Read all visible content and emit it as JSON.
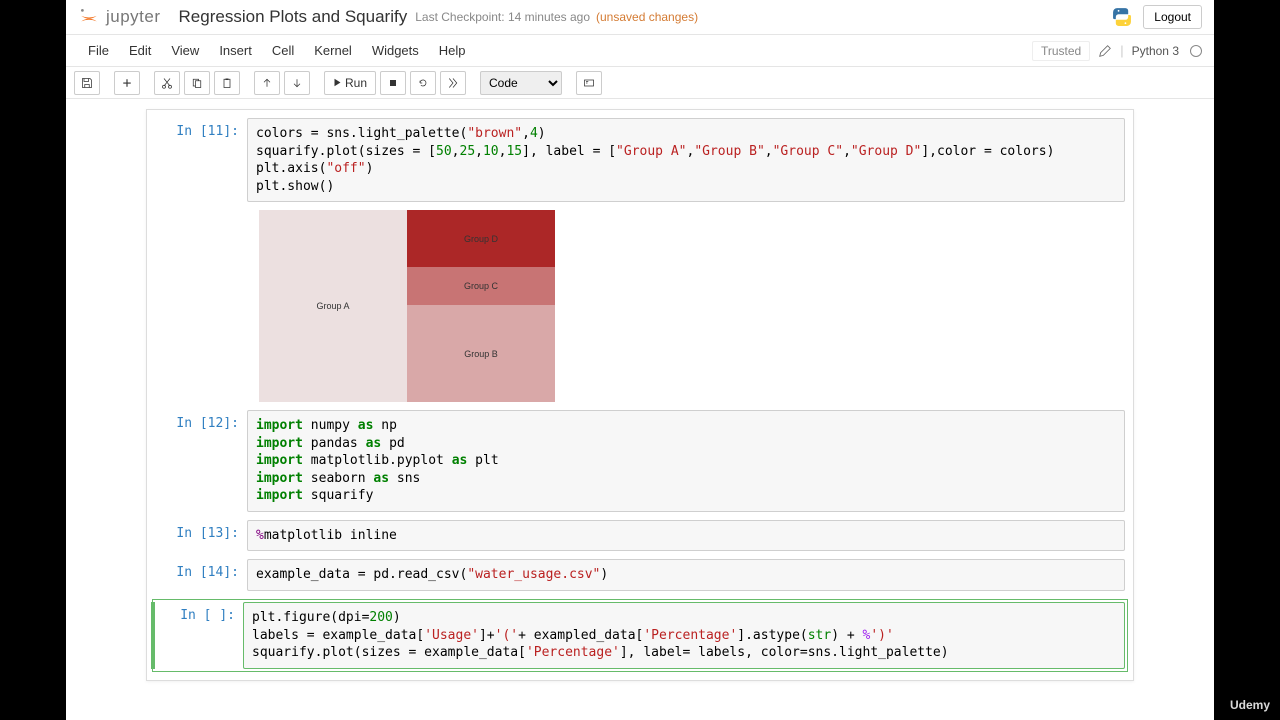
{
  "header": {
    "logo_text": "jupyter",
    "title": "Regression Plots and Squarify",
    "checkpoint": "Last Checkpoint: 14 minutes ago",
    "unsaved": "(unsaved changes)",
    "logout": "Logout"
  },
  "menu": {
    "file": "File",
    "edit": "Edit",
    "view": "View",
    "insert": "Insert",
    "cell": "Cell",
    "kernel": "Kernel",
    "widgets": "Widgets",
    "help": "Help",
    "trusted": "Trusted",
    "kernel_name": "Python 3"
  },
  "toolbar": {
    "run": "Run",
    "celltype": "Code"
  },
  "cells": {
    "c11_prompt": "In [11]:",
    "c12_prompt": "In [12]:",
    "c13_prompt": "In [13]:",
    "c14_prompt": "In [14]:",
    "c_empty_prompt": "In [ ]:"
  },
  "treemap": {
    "a": "Group A",
    "b": "Group B",
    "c": "Group C",
    "d": "Group D"
  },
  "chart_data": {
    "type": "area",
    "title": "",
    "series": [
      {
        "name": "Group A",
        "value": 50,
        "color": "#ece0e0"
      },
      {
        "name": "Group B",
        "value": 25,
        "color": "#d9a8a8"
      },
      {
        "name": "Group C",
        "value": 10,
        "color": "#c87474"
      },
      {
        "name": "Group D",
        "value": 15,
        "color": "#ac2727"
      }
    ]
  },
  "watermark": "Udemy"
}
